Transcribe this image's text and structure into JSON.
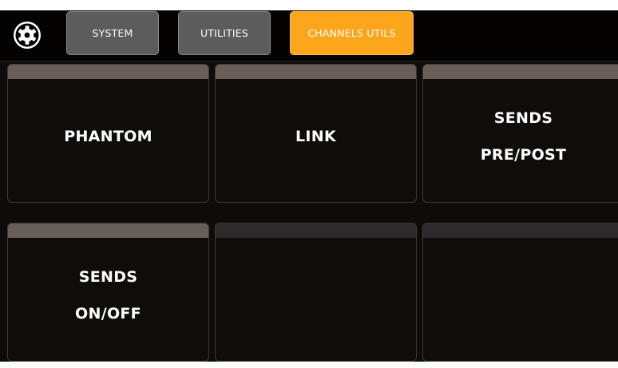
{
  "header": {
    "settings_icon": "gear-icon",
    "tabs": [
      {
        "label": "SYSTEM",
        "active": false
      },
      {
        "label": "UTILITIES",
        "active": false
      },
      {
        "label": "CHANNELS UTILS",
        "active": true
      }
    ]
  },
  "tiles": [
    {
      "lines": [
        "PHANTOM"
      ]
    },
    {
      "lines": [
        "LINK"
      ]
    },
    {
      "lines": [
        "SENDS",
        "PRE/POST"
      ]
    },
    {
      "lines": [
        "SENDS",
        "ON/OFF"
      ]
    },
    {
      "lines": []
    },
    {
      "lines": []
    }
  ],
  "colors": {
    "active_tab": "#fda51b",
    "inactive_tab": "#5d5c5c",
    "background": "#0e0b09",
    "tile_strip": "#675e59",
    "empty_tile_strip": "#2c2a2c"
  }
}
